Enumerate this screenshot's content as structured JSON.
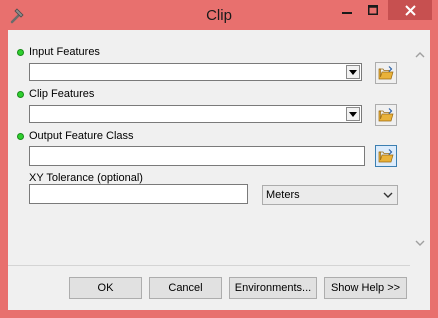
{
  "window": {
    "title": "Clip"
  },
  "fields": [
    {
      "label": "Input Features",
      "required": true,
      "value": ""
    },
    {
      "label": "Clip Features",
      "required": true,
      "value": ""
    },
    {
      "label": "Output Feature Class",
      "required": true,
      "value": ""
    },
    {
      "label": "XY Tolerance (optional)",
      "required": false,
      "value": "",
      "units": "Meters"
    }
  ],
  "buttons": {
    "ok": "OK",
    "cancel": "Cancel",
    "environments": "Environments...",
    "show_help": "Show Help >>"
  },
  "icons": {
    "app": "hammer-icon",
    "browse": "open-folder-icon",
    "minimize": "minimize-icon",
    "maximize": "maximize-icon",
    "close": "close-icon"
  },
  "colors": {
    "title_bar": "#e8706e",
    "close_button": "#c75050",
    "required_dot": "#2fd02f",
    "dialog_background": "#f0f0f0"
  }
}
